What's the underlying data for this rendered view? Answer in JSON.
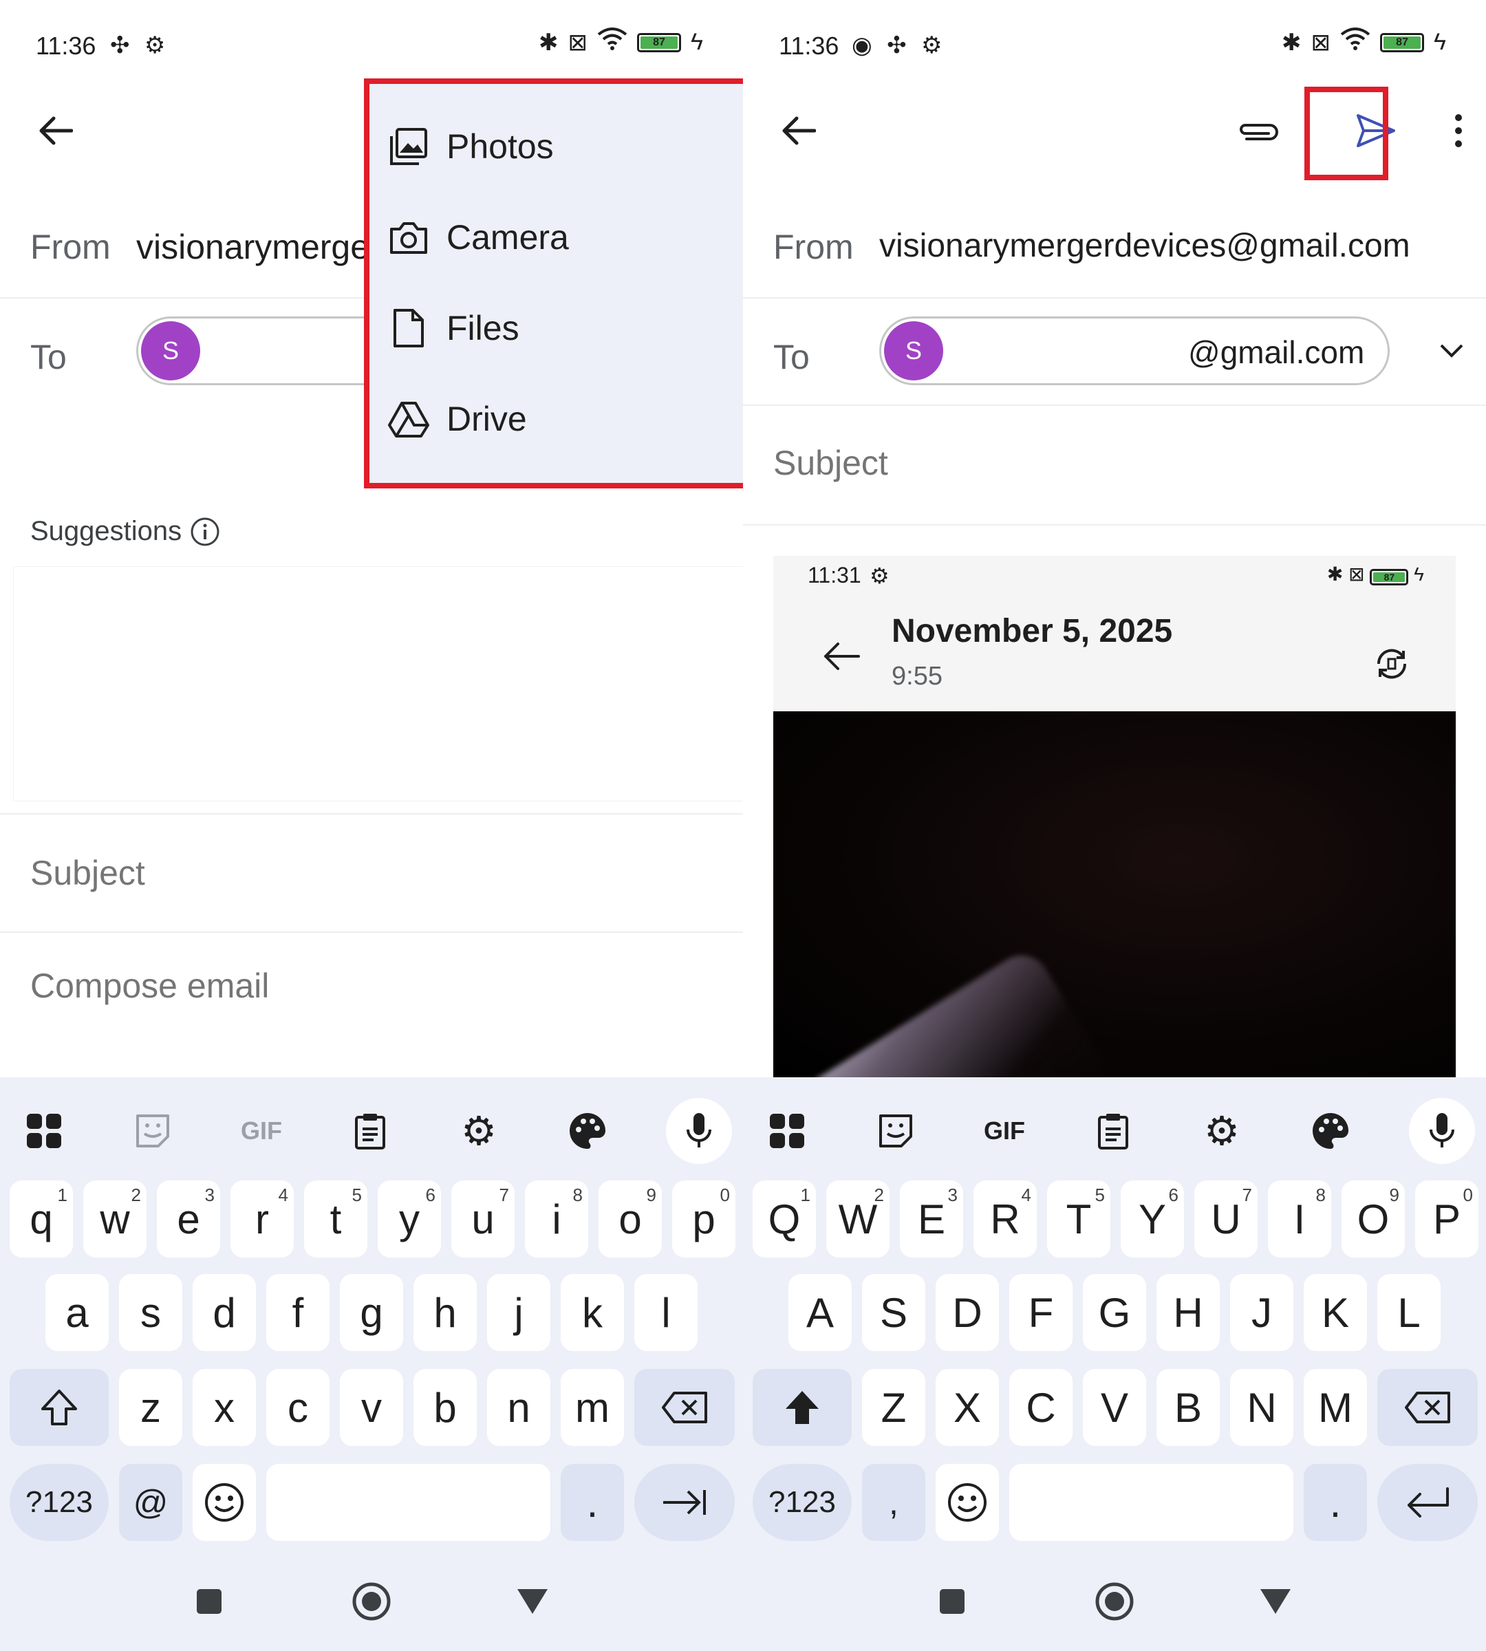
{
  "left": {
    "status": {
      "time": "11:36",
      "battery": "87"
    },
    "from_label": "From",
    "from_value": "visionarymerge",
    "to_label": "To",
    "recipient_initial": "S",
    "menu": {
      "items": [
        {
          "label": "Photos",
          "icon": "photos-icon"
        },
        {
          "label": "Camera",
          "icon": "camera-icon"
        },
        {
          "label": "Files",
          "icon": "file-icon"
        },
        {
          "label": "Drive",
          "icon": "drive-icon"
        }
      ]
    },
    "suggestions_label": "Suggestions",
    "subject_placeholder": "Subject",
    "body_placeholder": "Compose email",
    "keyboard": {
      "toolbar": [
        "apps-icon",
        "sticker-icon",
        "GIF",
        "clipboard-icon",
        "settings-icon",
        "palette-icon",
        "mic-icon"
      ],
      "row1": [
        [
          "q",
          "1"
        ],
        [
          "w",
          "2"
        ],
        [
          "e",
          "3"
        ],
        [
          "r",
          "4"
        ],
        [
          "t",
          "5"
        ],
        [
          "y",
          "6"
        ],
        [
          "u",
          "7"
        ],
        [
          "i",
          "8"
        ],
        [
          "o",
          "9"
        ],
        [
          "p",
          "0"
        ]
      ],
      "row2": [
        "a",
        "s",
        "d",
        "f",
        "g",
        "h",
        "j",
        "k",
        "l"
      ],
      "row3": [
        "z",
        "x",
        "c",
        "v",
        "b",
        "n",
        "m"
      ],
      "sym_key": "?123",
      "at_key": "@",
      "period_key": "."
    }
  },
  "right": {
    "status": {
      "time": "11:36",
      "battery": "87"
    },
    "from_label": "From",
    "from_value": "visionarymergerdevices@gmail.com",
    "to_label": "To",
    "recipient_initial": "S",
    "recipient_email_suffix": "@gmail.com",
    "subject_placeholder": "Subject",
    "attachment": {
      "time": "11:31",
      "battery": "87",
      "title": "November 5, 2025",
      "subtitle": "9:55"
    },
    "keyboard": {
      "toolbar": [
        "apps-icon",
        "sticker-icon",
        "GIF",
        "clipboard-icon",
        "settings-icon",
        "palette-icon",
        "mic-icon"
      ],
      "row1": [
        [
          "Q",
          "1"
        ],
        [
          "W",
          "2"
        ],
        [
          "E",
          "3"
        ],
        [
          "R",
          "4"
        ],
        [
          "T",
          "5"
        ],
        [
          "Y",
          "6"
        ],
        [
          "U",
          "7"
        ],
        [
          "I",
          "8"
        ],
        [
          "O",
          "9"
        ],
        [
          "P",
          "0"
        ]
      ],
      "row2": [
        "A",
        "S",
        "D",
        "F",
        "G",
        "H",
        "J",
        "K",
        "L"
      ],
      "row3": [
        "Z",
        "X",
        "C",
        "V",
        "B",
        "N",
        "M"
      ],
      "sym_key": "?123",
      "comma_key": ",",
      "period_key": "."
    }
  },
  "colors": {
    "accent": "#a142c6",
    "highlight": "#e11d2a",
    "keyboard_bg": "#edf0f8",
    "send": "#3f51b5"
  }
}
